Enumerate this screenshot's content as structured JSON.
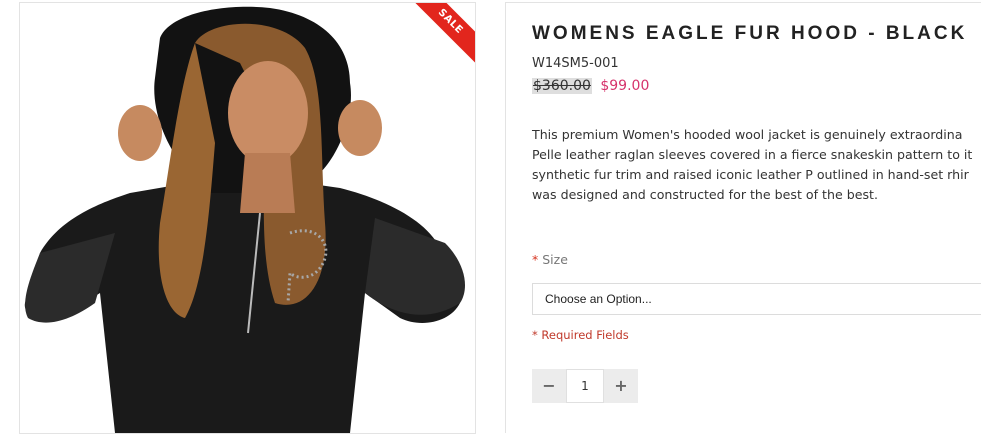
{
  "product_image": {
    "alt_icon": "product-photo",
    "sale_badge": "SALE"
  },
  "product": {
    "title": "WOMENS EAGLE FUR HOOD - BLACK",
    "sku": "W14SM5-001",
    "old_price": "$360.00",
    "new_price": "$99.00",
    "description_lines": [
      "This premium Women's hooded wool jacket is genuinely extraordina",
      "Pelle leather raglan sleeves covered in a fierce snakeskin pattern to it",
      "synthetic fur trim and raised iconic leather P outlined in hand-set rhir",
      "was designed and constructed for the best of the best."
    ]
  },
  "options": {
    "size_required_marker": "*",
    "size_label": "Size",
    "size_select_value": "Choose an Option...",
    "required_fields_note": "* Required Fields"
  },
  "quantity": {
    "minus_label": "−",
    "value": "1",
    "plus_label": "+"
  },
  "colors": {
    "sale_red": "#e2261d",
    "price_pink": "#d6336c",
    "required_red": "#c0392b"
  }
}
